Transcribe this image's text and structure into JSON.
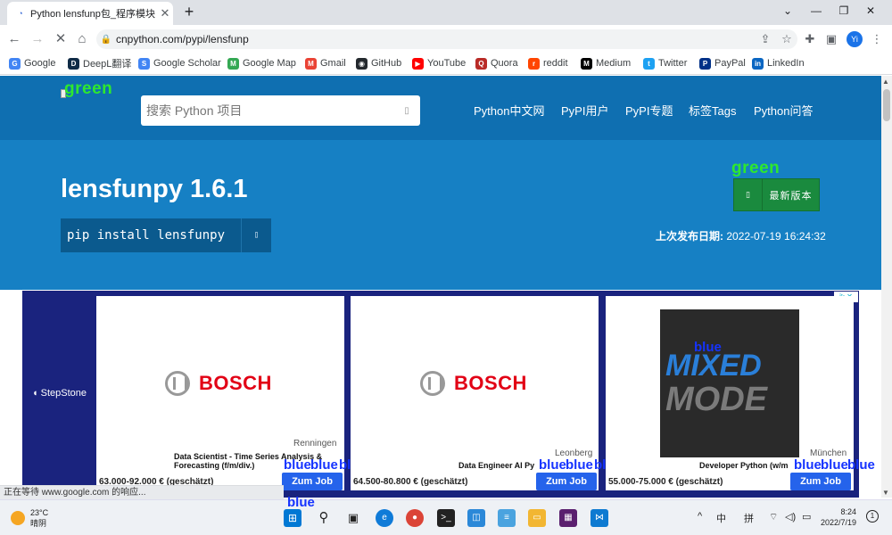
{
  "browser": {
    "tab_title": "Python lensfunp包_程序模块 - P",
    "url": "cnpython.com/pypi/lensfunp",
    "avatar_initials": "Yi",
    "bookmarks": [
      "Google",
      "DeepL翻译",
      "Google Scholar",
      "Google Map",
      "Gmail",
      "GitHub",
      "YouTube",
      "Quora",
      "reddit",
      "Medium",
      "Twitter",
      "PayPal",
      "LinkedIn"
    ]
  },
  "site": {
    "logo_tag": "green",
    "search_placeholder": "搜索 Python 项目",
    "nav": [
      "Python中文网",
      "PyPI用户",
      "PyPI专题",
      "标签Tags",
      "Python问答"
    ]
  },
  "package": {
    "title": "lensfunpy 1.6.1",
    "pip_command": "pip install lensfunpy",
    "version_tag": "green",
    "version_button": "最新版本",
    "release_label": "上次发布日期:",
    "release_date": "2022-07-19 16:24:32"
  },
  "ad": {
    "brand": "StepStone",
    "tag": "blue",
    "cards": [
      {
        "company": "BOSCH",
        "location": "Renningen",
        "job": "Data Scientist - Time Series Analysis & Forecasting (f/m/div.)",
        "salary": "63.000-92.000 € (geschätzt)",
        "button": "Zum Job"
      },
      {
        "company": "BOSCH",
        "location": "Leonberg",
        "job": "Data Engineer AI Py",
        "salary": "64.500-80.800 € (geschätzt)",
        "button": "Zum Job"
      },
      {
        "company": "MIXED MODE",
        "logo_line1": "MIXED",
        "logo_line2": "MODE",
        "location": "München",
        "job": "Developer Python (w/m",
        "salary": "55.000-75.000 € (geschätzt)",
        "button": "Zum Job"
      }
    ]
  },
  "status_text": "正在等待 www.google.com 的响应...",
  "taskbar": {
    "weather_temp": "23°C",
    "weather_desc": "晴阴",
    "ime_lang": "中",
    "ime_mode": "拼",
    "time": "8:24",
    "date": "2022/7/19",
    "notif_count": "1"
  }
}
